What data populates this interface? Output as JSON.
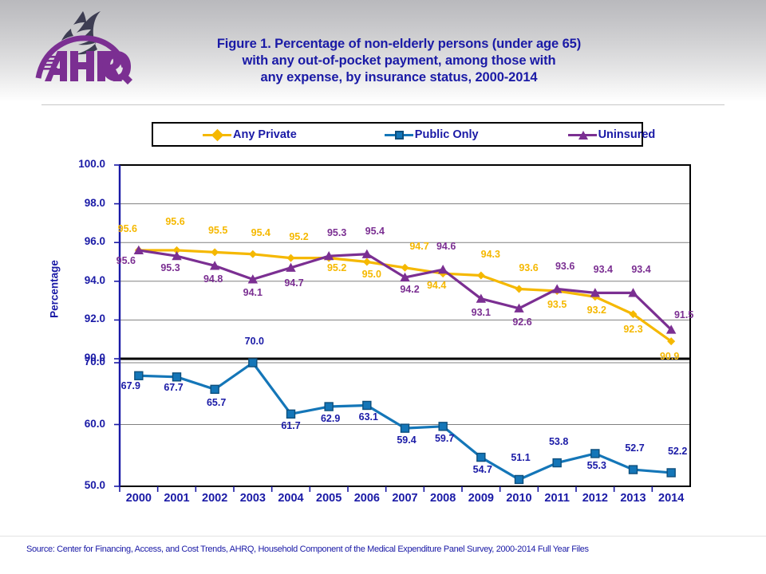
{
  "header": {
    "logo_alt": "ahrq-logo",
    "title_lines": [
      "Figure 1. Percentage of non-elderly persons (under age 65)",
      "with any out-of-pocket payment, among those with",
      "any expense, by insurance status, 2000-2014"
    ]
  },
  "source": {
    "text": "Source: Center for Financing, Access, and Cost Trends, AHRQ, Household Component of the Medical Expenditure Panel Survey,  2000-2014 Full Year Files"
  },
  "colors": {
    "any_private": "#f5b800",
    "public_only": "#1476b8",
    "uninsured": "#7b2f92",
    "text_blue": "#1a1aa6",
    "axis": "#000000",
    "grid": "#808080"
  },
  "chart_data": {
    "type": "line",
    "title": "Figure 1. Percentage of non-elderly persons (under age 65) with any out-of-pocket payment, among those with any expense, by insurance status, 2000-2014",
    "xlabel": "",
    "ylabel": "Percentage",
    "grid": true,
    "legend_position": "top",
    "broken_axis": true,
    "upper_ylim": [
      90.0,
      100.0
    ],
    "upper_yticks": [
      "100.0",
      "98.0",
      "96.0",
      "94.0",
      "92.0",
      "90.0"
    ],
    "lower_ylim": [
      50.0,
      70.0
    ],
    "lower_yticks": [
      "70.0",
      "60.0",
      "50.0"
    ],
    "categories": [
      "2000",
      "2001",
      "2002",
      "2003",
      "2004",
      "2005",
      "2006",
      "2007",
      "2008",
      "2009",
      "2010",
      "2011",
      "2012",
      "2013",
      "2014"
    ],
    "series": [
      {
        "name": "Any Private",
        "marker": "diamond",
        "color": "#f5b800",
        "panel": "upper",
        "values": [
          95.6,
          95.6,
          95.5,
          95.4,
          95.2,
          95.2,
          95.0,
          94.7,
          94.4,
          94.3,
          93.6,
          93.5,
          93.2,
          92.3,
          90.9
        ],
        "labels": [
          "95.6",
          "95.6",
          "95.5",
          "95.4",
          "95.2",
          "95.2",
          "95.0",
          "94.7",
          "94.4",
          "94.3",
          "93.6",
          "93.5",
          "93.2",
          "92.3",
          "90.9"
        ]
      },
      {
        "name": "Public Only",
        "marker": "square",
        "color": "#1476b8",
        "panel": "lower",
        "values": [
          67.9,
          67.7,
          65.7,
          70.0,
          61.7,
          62.9,
          63.1,
          59.4,
          59.7,
          54.7,
          51.1,
          53.8,
          55.3,
          52.7,
          52.2
        ],
        "labels": [
          "67.9",
          "67.7",
          "65.7",
          "70.0",
          "61.7",
          "62.9",
          "63.1",
          "59.4",
          "59.7",
          "54.7",
          "51.1",
          "53.8",
          "55.3",
          "52.7",
          "52.2"
        ]
      },
      {
        "name": "Uninsured",
        "marker": "triangle",
        "color": "#7b2f92",
        "panel": "upper",
        "values": [
          95.6,
          95.3,
          94.8,
          94.1,
          94.7,
          95.3,
          95.4,
          94.2,
          94.6,
          93.1,
          92.6,
          93.6,
          93.4,
          93.4,
          91.5
        ],
        "labels": [
          "95.6",
          "95.3",
          "94.8",
          "94.1",
          "94.7",
          "95.3",
          "95.4",
          "94.2",
          "94.6",
          "93.1",
          "92.6",
          "93.6",
          "93.4",
          "93.4",
          "91.5"
        ]
      }
    ]
  }
}
